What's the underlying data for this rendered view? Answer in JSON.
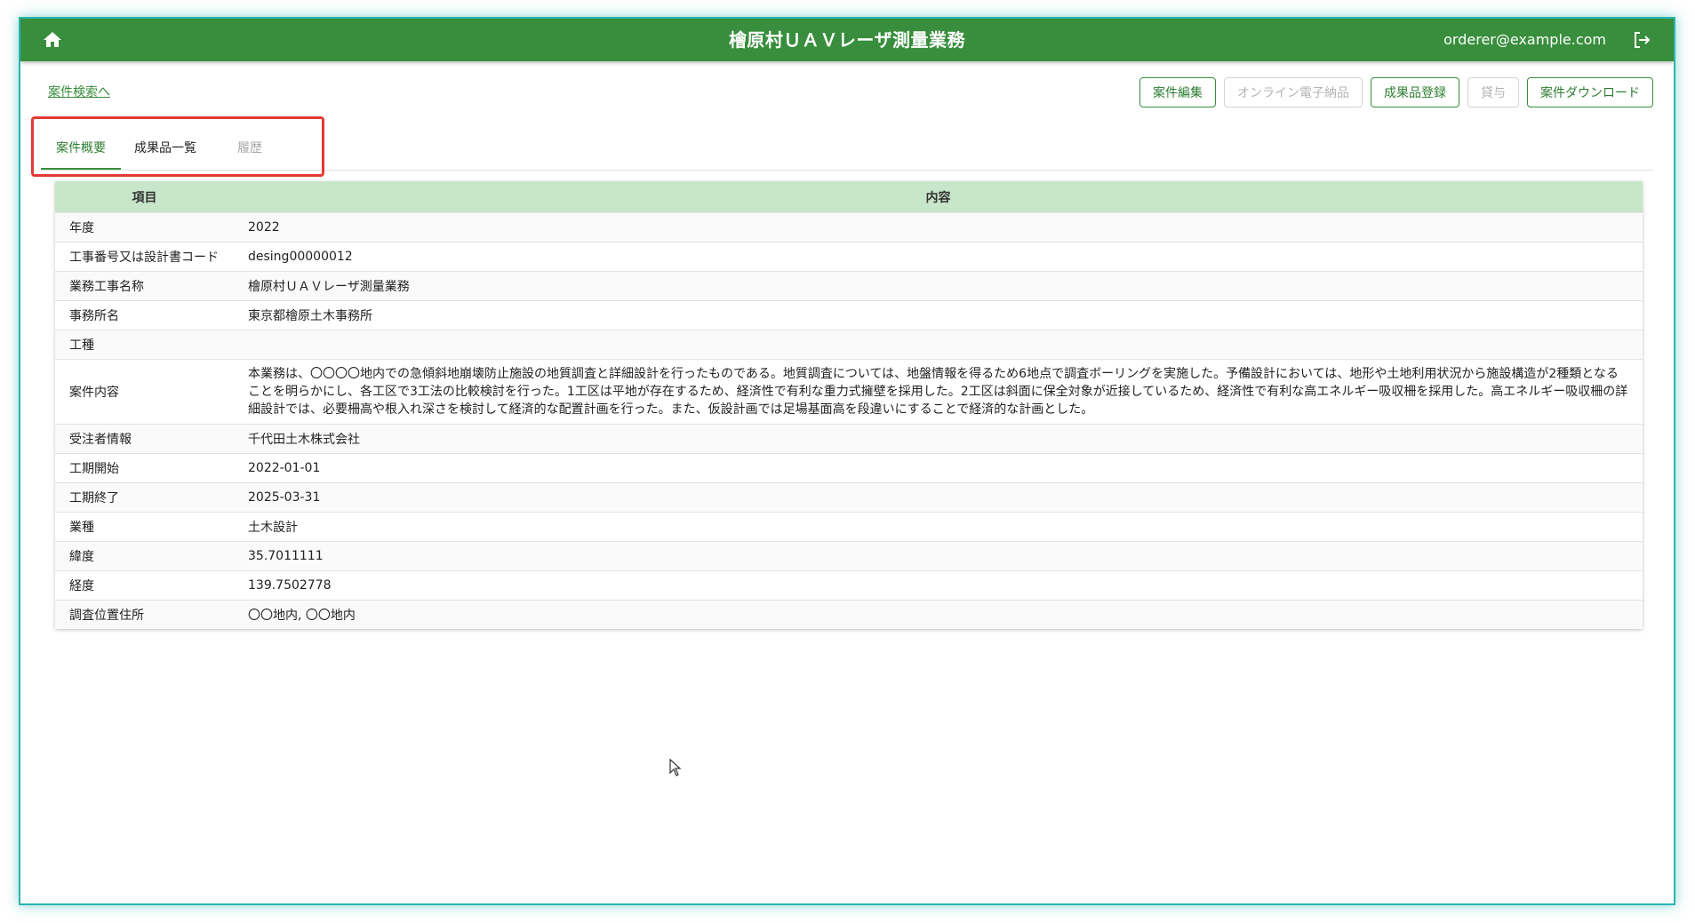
{
  "header": {
    "title": "檜原村ＵＡＶレーザ測量業務",
    "user_email": "orderer@example.com"
  },
  "nav": {
    "back_link": "案件検索へ"
  },
  "actions": {
    "edit": "案件編集",
    "online_delivery": "オンライン電子納品",
    "register_deliverable": "成果品登録",
    "lend": "貸与",
    "download": "案件ダウンロード"
  },
  "tabs": [
    {
      "label": "案件概要",
      "active": true
    },
    {
      "label": "成果品一覧",
      "active": false
    },
    {
      "label": "履歴",
      "active": false,
      "disabled": true
    }
  ],
  "table": {
    "headers": {
      "item": "項目",
      "content": "内容"
    },
    "rows": [
      {
        "label": "年度",
        "value": "2022"
      },
      {
        "label": "工事番号又は設計書コード",
        "value": "desing00000012"
      },
      {
        "label": "業務工事名称",
        "value": "檜原村ＵＡＶレーザ測量業務"
      },
      {
        "label": "事務所名",
        "value": "東京都檜原土木事務所"
      },
      {
        "label": "工種",
        "value": ""
      },
      {
        "label": "案件内容",
        "value": "本業務は、〇〇〇〇地内での急傾斜地崩壊防止施設の地質調査と詳細設計を行ったものである。地質調査については、地盤情報を得るため6地点で調査ボーリングを実施した。予備設計においては、地形や土地利用状況から施設構造が2種類となることを明らかにし、各工区で3工法の比較検討を行った。1工区は平地が存在するため、経済性で有利な重力式擁壁を採用した。2工区は斜面に保全対象が近接しているため、経済性で有利な高エネルギー吸収柵を採用した。高エネルギー吸収柵の詳細設計では、必要柵高や根入れ深さを検討して経済的な配置計画を行った。また、仮設計画では足場基面高を段違いにすることで経済的な計画とした。"
      },
      {
        "label": "受注者情報",
        "value": "千代田土木株式会社"
      },
      {
        "label": "工期開始",
        "value": "2022-01-01"
      },
      {
        "label": "工期終了",
        "value": "2025-03-31"
      },
      {
        "label": "業種",
        "value": "土木設計"
      },
      {
        "label": "緯度",
        "value": "35.7011111"
      },
      {
        "label": "経度",
        "value": "139.7502778"
      },
      {
        "label": "調査位置住所",
        "value": "〇〇地内, 〇〇地内"
      }
    ]
  },
  "colors": {
    "primary": "#388e3c",
    "table_header": "#c8e6c9",
    "highlight": "#e53935",
    "frame": "#2bb5b0"
  },
  "icons": {
    "home": "home-icon",
    "logout": "logout-icon"
  }
}
